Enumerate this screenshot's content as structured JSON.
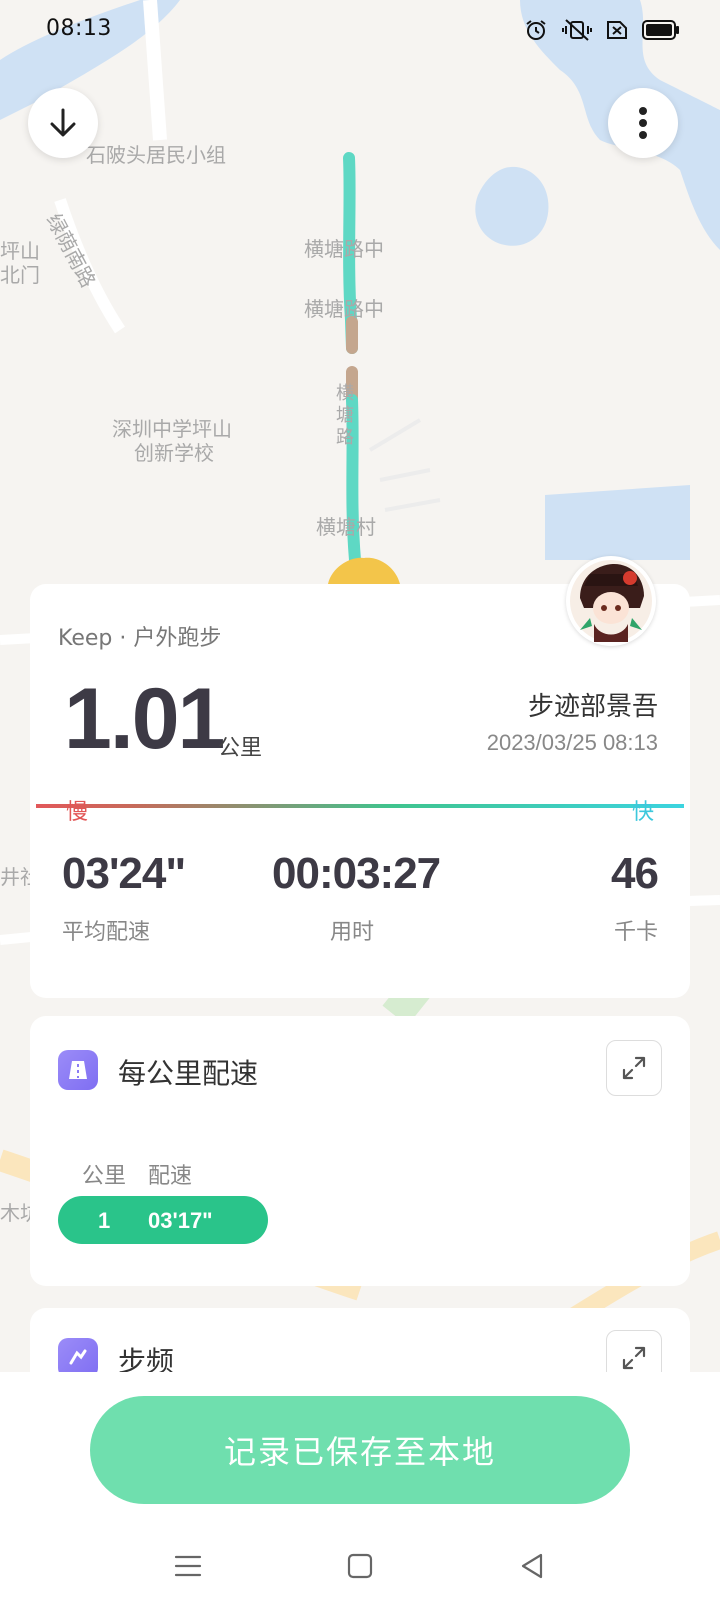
{
  "status_bar": {
    "time": "08:13",
    "icons": [
      "alarm-icon",
      "vibrate-off-icon",
      "sim-error-icon",
      "battery-full-icon"
    ]
  },
  "map": {
    "labels": [
      "石陂头居民小组",
      "绿荫南路",
      "坪山",
      "北门",
      "横塘路中",
      "横塘路中",
      "横",
      "塘",
      "路",
      "深圳中学坪山",
      "创新学校",
      "横塘村",
      "井社",
      "木坑"
    ],
    "route_color": "#5ed8c4"
  },
  "map_buttons": {
    "collapse_icon": "arrow-down-icon",
    "more_icon": "more-vertical-icon"
  },
  "summary": {
    "source": "Keep · 户外跑步",
    "distance": "1.01",
    "distance_unit": "公里",
    "username": "步迹部景吾",
    "datetime": "2023/03/25 08:13",
    "slow_label": "慢",
    "fast_label": "快",
    "stats": [
      {
        "value": "03'24\"",
        "label": "平均配速"
      },
      {
        "value": "00:03:27",
        "label": "用时"
      },
      {
        "value": "46",
        "label": "千卡"
      }
    ]
  },
  "pace_section": {
    "title": "每公里配速",
    "col_km": "公里",
    "col_pace": "配速",
    "splits": [
      {
        "km": "1",
        "pace": "03'17\""
      }
    ]
  },
  "cadence_section": {
    "title": "步频"
  },
  "save_button": "记录已保存至本地",
  "colors": {
    "accent_green": "#2ac48a",
    "button_green": "#6fdfae",
    "slow_red": "#e25555",
    "fast_cyan": "#3cc8dc",
    "section_purple": "#8b7cf5"
  }
}
